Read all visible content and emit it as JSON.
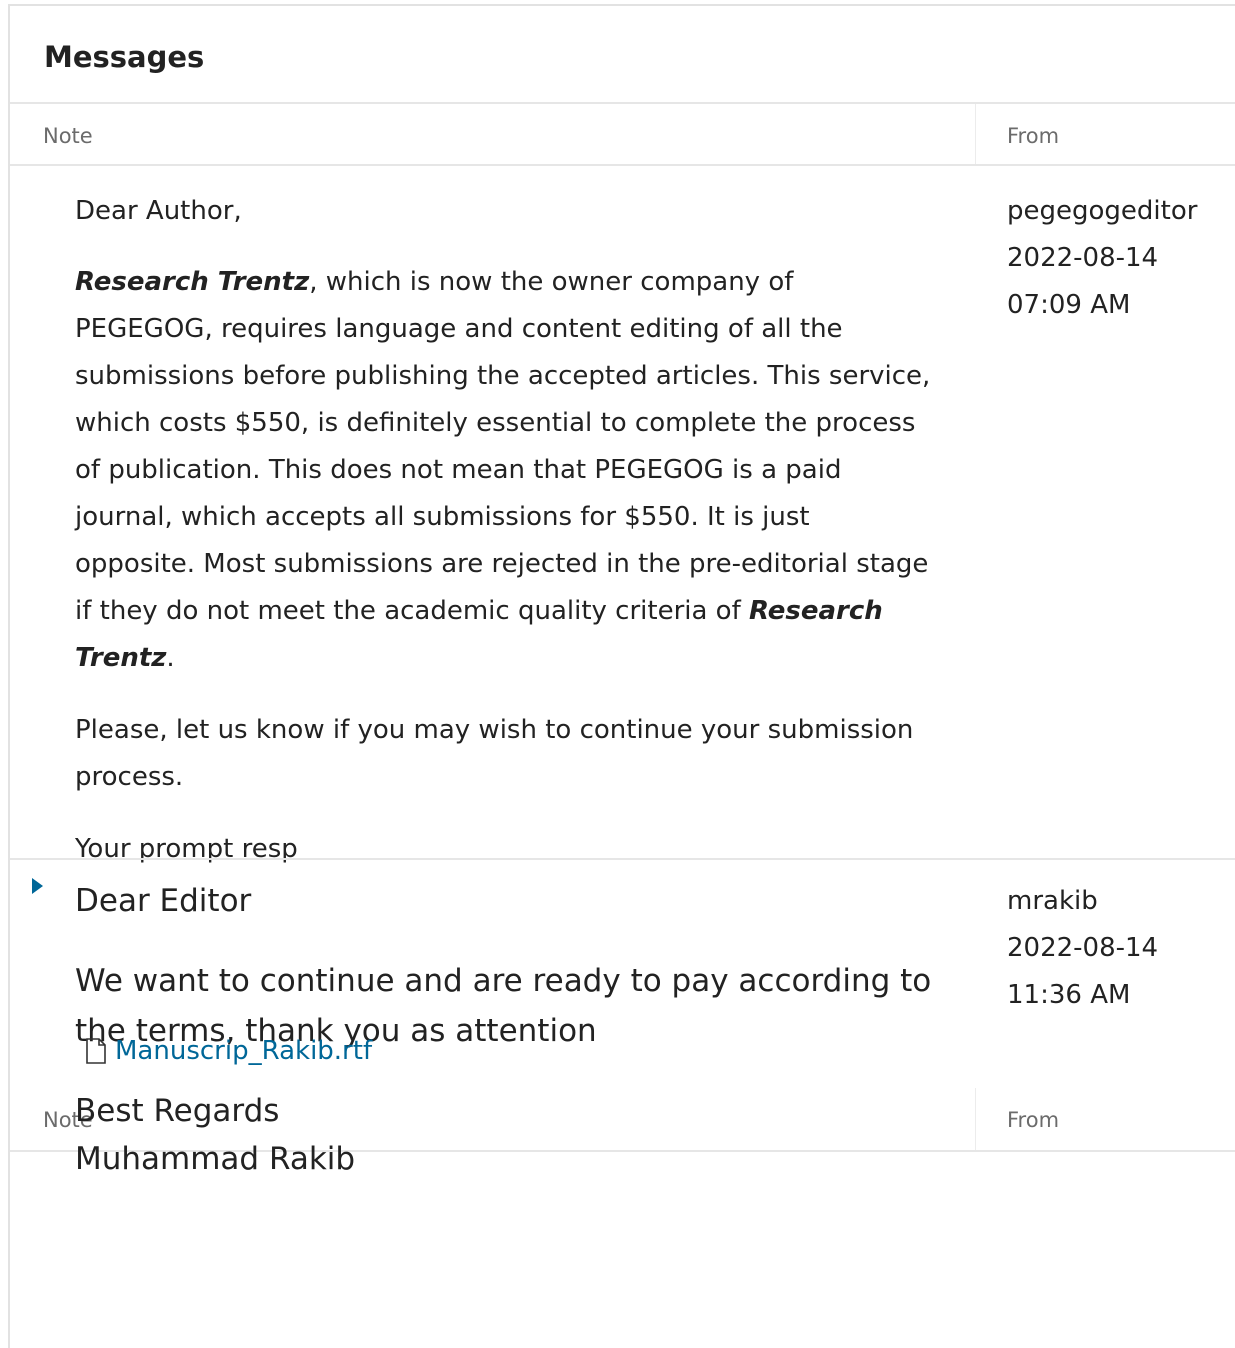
{
  "panel": {
    "title": "Messages"
  },
  "table": {
    "col_note": "Note",
    "col_from": "From"
  },
  "messages": [
    {
      "greeting": "Dear Author,",
      "p1_em": "Research Trentz",
      "p1_text": ", which is now the owner company of PEGEGOG, requires language and content editing of all the submissions before publishing the accepted articles. This service, which costs $550, is definitely essential to complete the process of publication. This does not mean that PEGEGOG is a paid journal, which accepts all submissions for $550. It is just opposite. Most submissions are rejected in the pre-editorial stage if they do not meet the academic quality criteria of ",
      "p1_em2": "Research Trentz",
      "p1_end": ".",
      "p2": "Please, let us know if you may wish to continue your submission process.",
      "p3": "Your prompt resp",
      "from_user": "pegegogeditor",
      "date": "2022-08-14",
      "time": "07:09 AM"
    },
    {
      "greeting": "Dear Editor",
      "body": "We want to continue and are ready to pay according to the terms, thank you as attention",
      "closing": "Best Regards",
      "signature": "Muhammad Rakib",
      "attachment": "Manuscrip_Rakib.rtf",
      "from_user": "mrakib",
      "date": "2022-08-14",
      "time": "11:36 AM"
    }
  ],
  "colors": {
    "accent": "#006798",
    "border": "#e6e6e6"
  },
  "icons": {
    "expand": "triangle-right-icon",
    "file": "file-icon"
  }
}
